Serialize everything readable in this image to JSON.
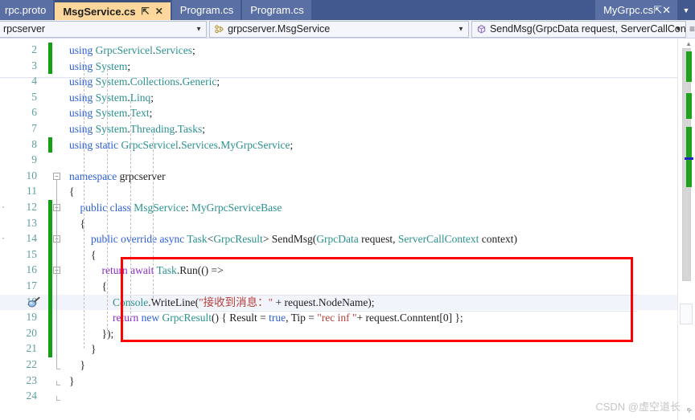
{
  "window": {
    "tab_dropdown_icon": "chevron-down-icon"
  },
  "tabs": [
    {
      "label": "rpc.proto",
      "active": false,
      "pin": "",
      "close": ""
    },
    {
      "label": "MsgService.cs",
      "active": true,
      "pin": "⇱",
      "close": "✕"
    },
    {
      "label": "Program.cs",
      "active": false,
      "pin": "",
      "close": ""
    },
    {
      "label": "Program.cs",
      "active": false,
      "pin": "",
      "close": ""
    }
  ],
  "tab_right": {
    "label": "MyGrpc.cs",
    "pin": "⇱",
    "close": "✕"
  },
  "navbar": {
    "project": "rpcserver",
    "class": "grpcserver.MsgService",
    "member": "SendMsg(GrpcData request, ServerCallConte",
    "project_icon": "chevron-down-icon",
    "class_icon": "class-icon",
    "member_icon": "method-icon",
    "end_glyph": "≡"
  },
  "code": {
    "lines": [
      {
        "num": "2",
        "text": "using GrpcServicel.Services;"
      },
      {
        "num": "3",
        "text": "using System;"
      },
      {
        "num": "4",
        "text": "using System.Collections.Generic;"
      },
      {
        "num": "5",
        "text": "using System.Linq;"
      },
      {
        "num": "6",
        "text": "using System.Text;"
      },
      {
        "num": "7",
        "text": "using System.Threading.Tasks;"
      },
      {
        "num": "8",
        "text": "using static GrpcServicel.Services.MyGrpcService;"
      },
      {
        "num": "9",
        "text": ""
      },
      {
        "num": "10",
        "text": "namespace grpcserver"
      },
      {
        "num": "11",
        "text": "{"
      },
      {
        "num": "12",
        "text": "    public class MsgService: MyGrpcServiceBase"
      },
      {
        "num": "13",
        "text": "    {"
      },
      {
        "num": "14",
        "text": "        public override async Task<GrpcResult> SendMsg(GrpcData request, ServerCallContext context)"
      },
      {
        "num": "15",
        "text": "        {"
      },
      {
        "num": "16",
        "text": "            return await Task.Run(() =>"
      },
      {
        "num": "17",
        "text": "            {"
      },
      {
        "num": "18",
        "text": "                Console.WriteLine(\"接收到消息：\" + request.NodeName);"
      },
      {
        "num": "19",
        "text": "                return new GrpcResult() { Result = true, Tip = \"rec inf \"+ request.Conntent[0] };"
      },
      {
        "num": "20",
        "text": "            });"
      },
      {
        "num": "21",
        "text": "        }"
      },
      {
        "num": "22",
        "text": "    }"
      },
      {
        "num": "23",
        "text": "}"
      },
      {
        "num": "24",
        "text": ""
      }
    ],
    "current_line": "18",
    "bookmark_line": "18",
    "bookmark_icon": "bookmark-icon"
  },
  "annotation": {
    "type": "red-rectangle",
    "color": "#ff0000"
  },
  "colors": {
    "tabbar_bg": "#41598e",
    "active_tab_bg": "#fdd79b",
    "inactive_tab_bg": "#5a6fa3",
    "navbar_bg": "#eef1f8",
    "editor_bg": "#ffffff",
    "keyword": "#2b5fd9",
    "control_keyword": "#8b2fc9",
    "type": "#2b918e",
    "string": "#b5403a",
    "linenumber": "#5f9ea0",
    "changebar": "#14a014",
    "annotation": "#ff0000"
  },
  "watermark": {
    "text": "CSDN @虚空道长"
  },
  "scrollbar": {
    "up_icon": "scroll-up-icon",
    "down_icon": "scroll-down-icon"
  }
}
